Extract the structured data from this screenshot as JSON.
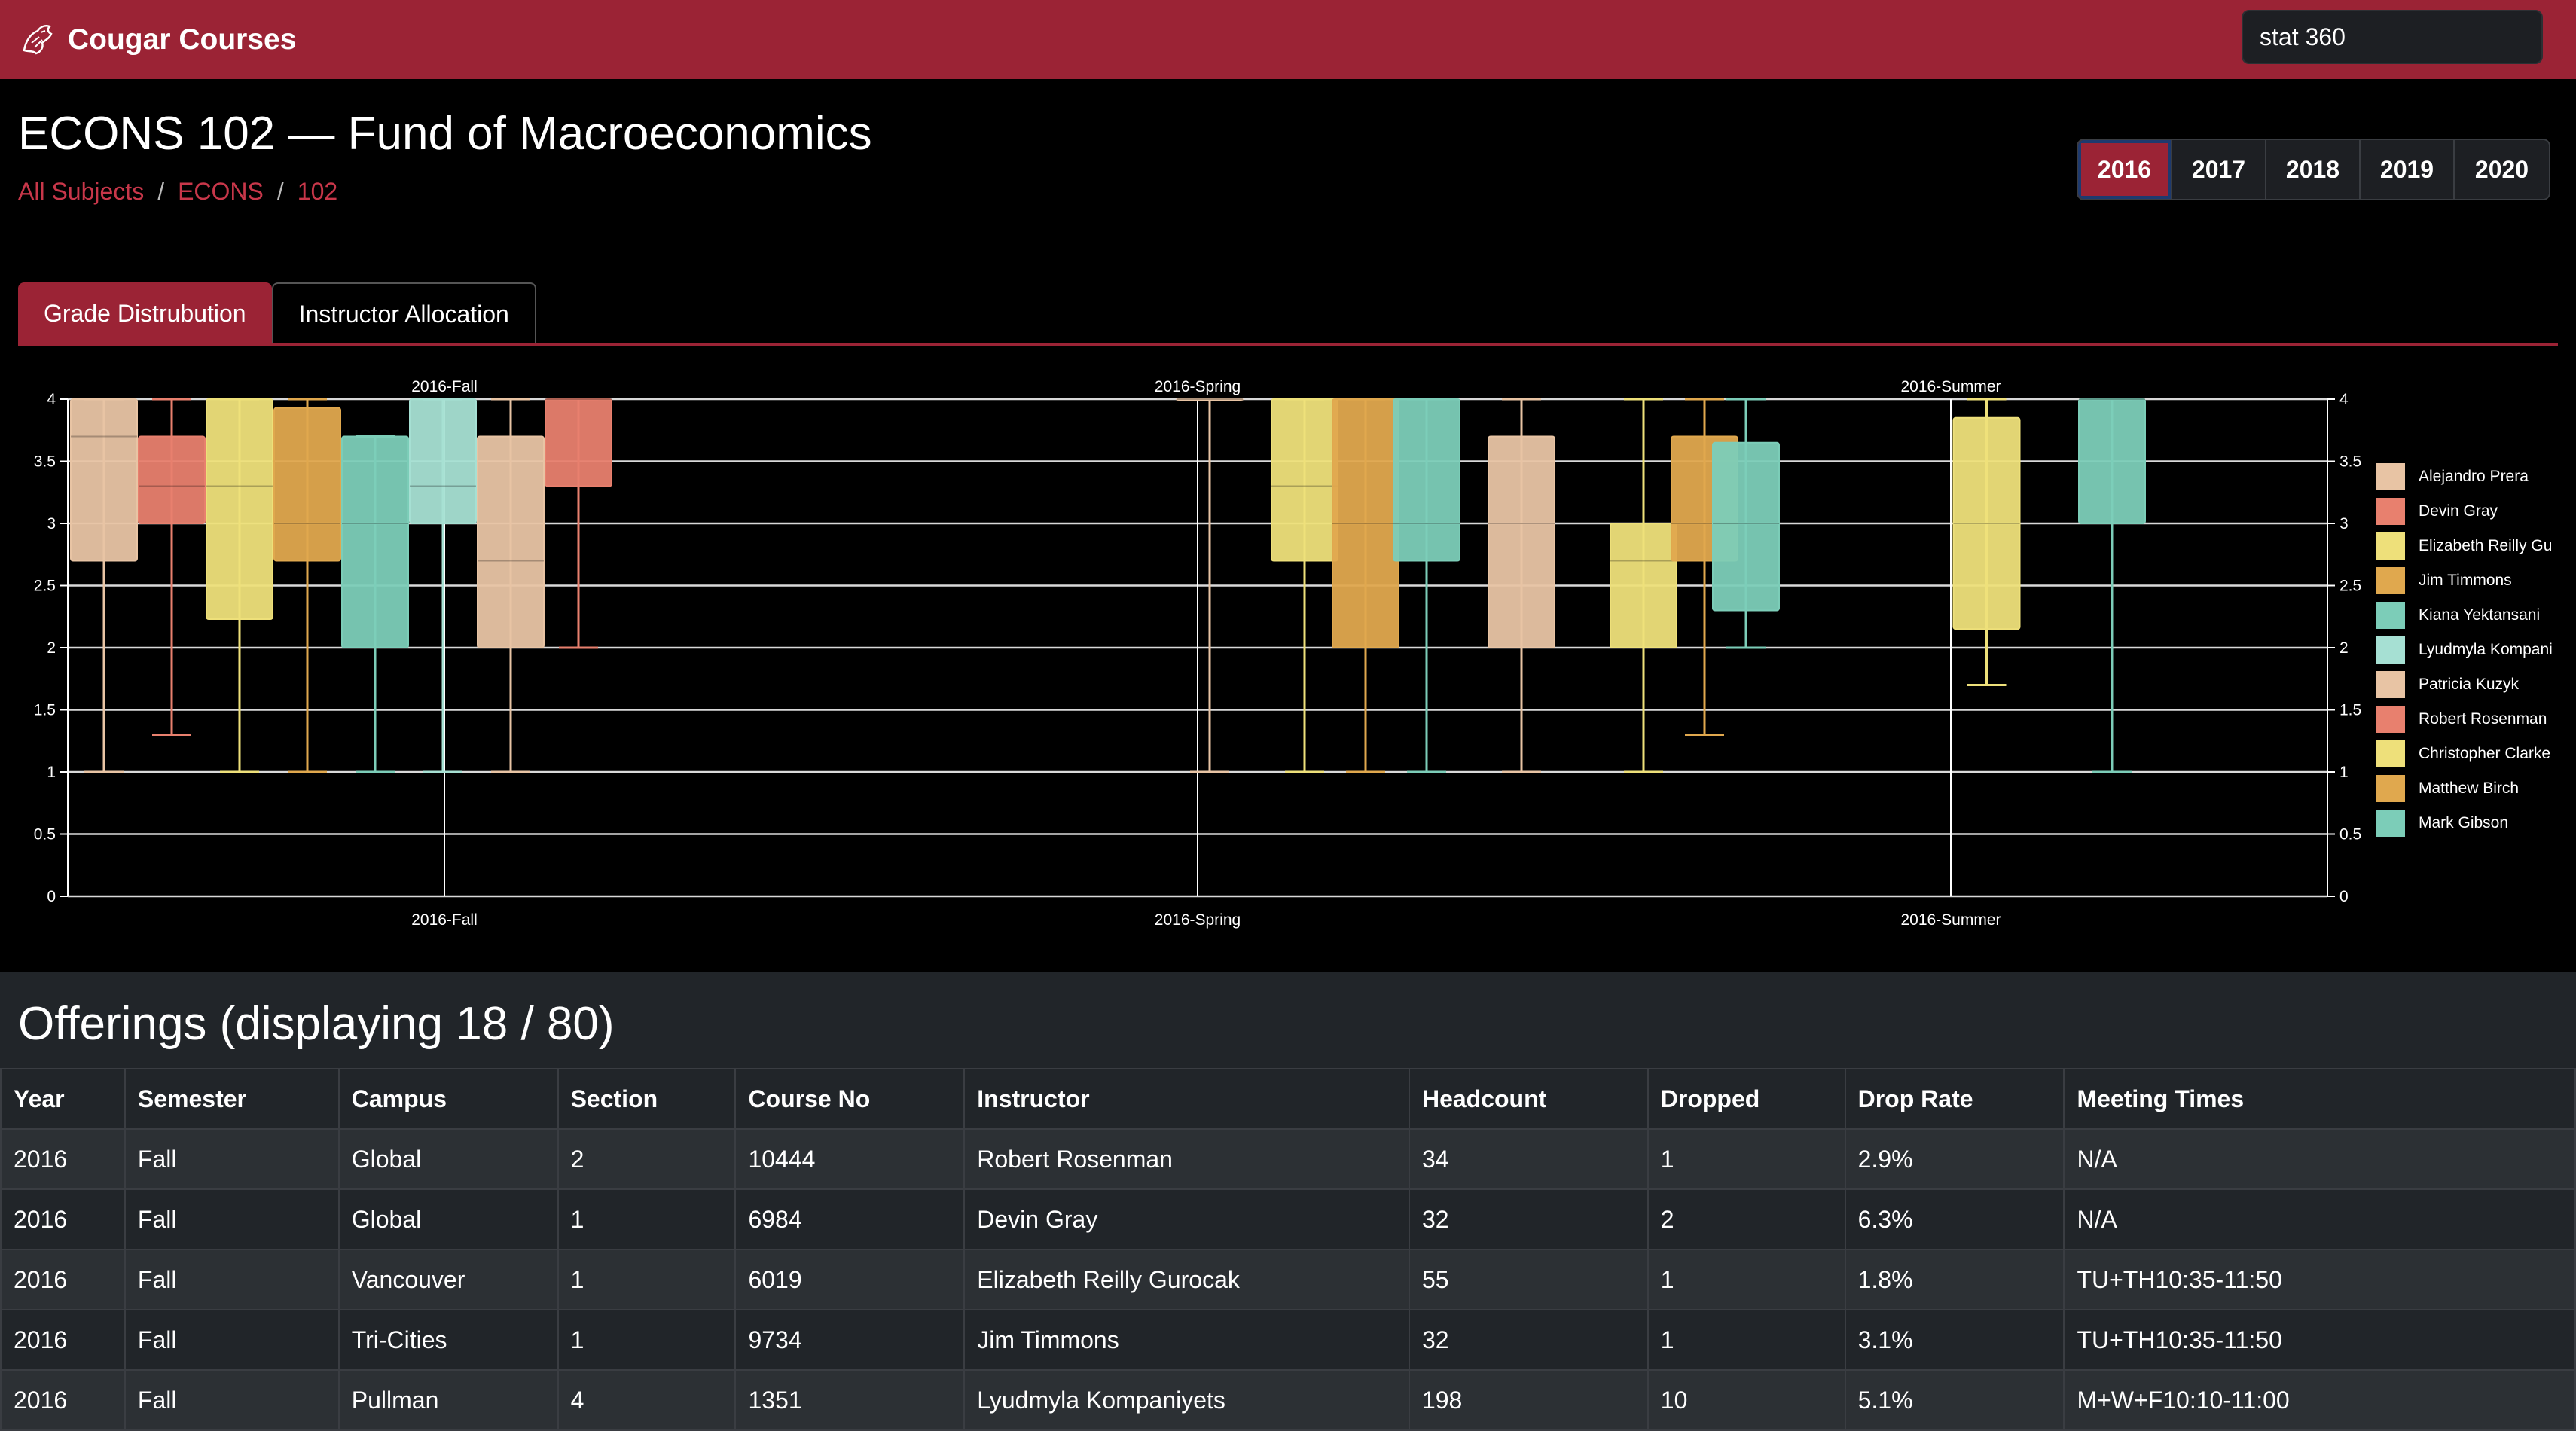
{
  "navbar": {
    "brand": "Cougar Courses",
    "brand_icon": "cougar-logo-icon",
    "search_value": "stat 360"
  },
  "page": {
    "title": "ECONS 102 — Fund of Macroeconomics",
    "breadcrumb": [
      "All Subjects",
      "ECONS",
      "102"
    ]
  },
  "years": {
    "options": [
      "2016",
      "2017",
      "2018",
      "2019",
      "2020"
    ],
    "selected": "2016"
  },
  "tabs": [
    {
      "label": "Grade Distrubution",
      "active": true
    },
    {
      "label": "Instructor Allocation",
      "active": false
    }
  ],
  "colors": {
    "brand": "#9b2335",
    "accent": "#c8374a"
  },
  "chart_data": {
    "type": "box",
    "ylim": [
      0,
      4
    ],
    "yticks": [
      "0",
      "0.5",
      "1",
      "1.5",
      "2",
      "2.5",
      "3",
      "3.5",
      "4"
    ],
    "categories": [
      "2016-Fall",
      "2016-Spring",
      "2016-Summer"
    ],
    "grid": true,
    "legend_position": "right",
    "legend": [
      {
        "name": "Alejandro Prera",
        "color": "#e8c4a4"
      },
      {
        "name": "Devin Gray",
        "color": "#e8806e"
      },
      {
        "name": "Elizabeth Reilly Gu",
        "color": "#eee07a"
      },
      {
        "name": "Jim Timmons",
        "color": "#e0a84e"
      },
      {
        "name": "Kiana Yektansani",
        "color": "#7ccdb8"
      },
      {
        "name": "Lyudmyla Kompani",
        "color": "#a6e0d3"
      },
      {
        "name": "Patricia Kuzyk",
        "color": "#e8c4a4"
      },
      {
        "name": "Robert Rosenman",
        "color": "#e8806e"
      },
      {
        "name": "Christopher Clarke",
        "color": "#eee07a"
      },
      {
        "name": "Matthew Birch",
        "color": "#e0a84e"
      },
      {
        "name": "Mark Gibson",
        "color": "#7ccdb8"
      }
    ],
    "groups": [
      {
        "category": "2016-Fall",
        "boxes": [
          {
            "instructor": "Alejandro Prera",
            "min": 1,
            "q1": 2.7,
            "median": 3.7,
            "q3": 4,
            "max": 4
          },
          {
            "instructor": "Devin Gray",
            "min": 1.3,
            "q1": 3,
            "median": 3.3,
            "q3": 3.7,
            "max": 4
          },
          {
            "instructor": "Elizabeth Reilly Gu",
            "min": 1,
            "q1": 2.23,
            "median": 3.3,
            "q3": 4,
            "max": 4
          },
          {
            "instructor": "Jim Timmons",
            "min": 1,
            "q1": 2.7,
            "median": 3,
            "q3": 3.93,
            "max": 4
          },
          {
            "instructor": "Kiana Yektansani",
            "min": 1,
            "q1": 2,
            "median": 3,
            "q3": 3.7,
            "max": 3.7
          },
          {
            "instructor": "Lyudmyla Kompani",
            "min": 1,
            "q1": 3,
            "median": 3.3,
            "q3": 4,
            "max": 4
          },
          {
            "instructor": "Patricia Kuzyk",
            "min": 1,
            "q1": 2,
            "median": 2.7,
            "q3": 3.7,
            "max": 4
          },
          {
            "instructor": "Robert Rosenman",
            "min": 2,
            "q1": 3.3,
            "median": 4,
            "q3": 4,
            "max": 4
          }
        ]
      },
      {
        "category": "2016-Spring",
        "boxes": [
          {
            "instructor": "Alejandro Prera",
            "min": 1,
            "q1": 4,
            "median": 4,
            "q3": 4,
            "max": 4
          },
          {
            "instructor": "Elizabeth Reilly Gu",
            "min": 1,
            "q1": 2.7,
            "median": 3.3,
            "q3": 4,
            "max": 4
          },
          {
            "instructor": "Jim Timmons",
            "min": 1,
            "q1": 2,
            "median": 3,
            "q3": 4,
            "max": 4
          },
          {
            "instructor": "Kiana Yektansani",
            "min": 1,
            "q1": 2.7,
            "median": 3,
            "q3": 4,
            "max": 4
          },
          {
            "instructor": "Patricia Kuzyk",
            "min": 1,
            "q1": 2,
            "median": 3,
            "q3": 3.7,
            "max": 4
          },
          {
            "instructor": "Christopher Clarke",
            "min": 1,
            "q1": 2,
            "median": 2.7,
            "q3": 3,
            "max": 4
          },
          {
            "instructor": "Matthew Birch",
            "min": 1.3,
            "q1": 2.7,
            "median": 3,
            "q3": 3.7,
            "max": 4
          }
        ]
      },
      {
        "category": "2016-Summer",
        "boxes": [
          {
            "instructor": "Kiana Yektansani",
            "min": 2,
            "q1": 2.3,
            "median": 3,
            "q3": 3.65,
            "max": 4
          },
          {
            "instructor": "Elizabeth Reilly Gu",
            "min": 1.7,
            "q1": 2.15,
            "median": 3,
            "q3": 3.85,
            "max": 4
          },
          {
            "instructor": "Mark Gibson",
            "min": 1,
            "q1": 3,
            "median": 4,
            "q3": 4,
            "max": 4
          }
        ]
      }
    ]
  },
  "offerings": {
    "title": "Offerings (displaying 18 / 80)",
    "columns": [
      "Year",
      "Semester",
      "Campus",
      "Section",
      "Course No",
      "Instructor",
      "Headcount",
      "Dropped",
      "Drop Rate",
      "Meeting Times"
    ],
    "rows": [
      [
        "2016",
        "Fall",
        "Global",
        "2",
        "10444",
        "Robert Rosenman",
        "34",
        "1",
        "2.9%",
        "N/A"
      ],
      [
        "2016",
        "Fall",
        "Global",
        "1",
        "6984",
        "Devin Gray",
        "32",
        "2",
        "6.3%",
        "N/A"
      ],
      [
        "2016",
        "Fall",
        "Vancouver",
        "1",
        "6019",
        "Elizabeth Reilly Gurocak",
        "55",
        "1",
        "1.8%",
        "TU+TH10:35-11:50"
      ],
      [
        "2016",
        "Fall",
        "Tri-Cities",
        "1",
        "9734",
        "Jim Timmons",
        "32",
        "1",
        "3.1%",
        "TU+TH10:35-11:50"
      ],
      [
        "2016",
        "Fall",
        "Pullman",
        "4",
        "1351",
        "Lyudmyla Kompaniyets",
        "198",
        "10",
        "5.1%",
        "M+W+F10:10-11:00"
      ]
    ]
  }
}
